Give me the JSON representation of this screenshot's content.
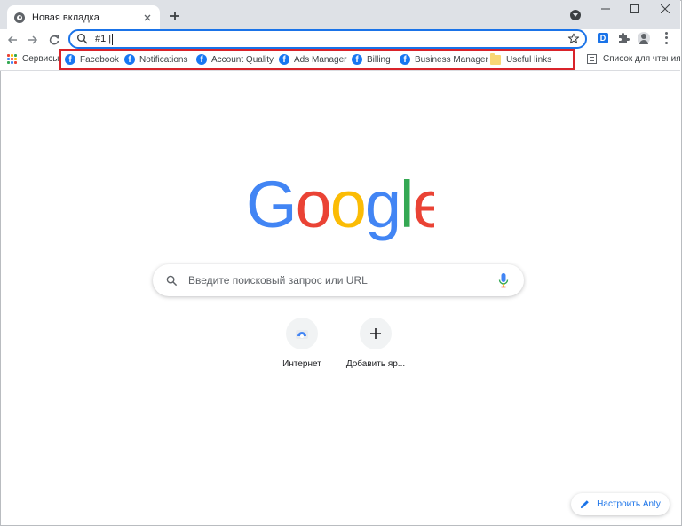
{
  "tab": {
    "title": "Новая вкладка",
    "close_icon": "close-icon",
    "new_tab_icon": "plus-icon"
  },
  "omnibox": {
    "value": "#1 |",
    "search_icon": "search-icon",
    "star_icon": "star-icon"
  },
  "toolbar": {
    "back_icon": "arrow-left-icon",
    "forward_icon": "arrow-right-icon",
    "reload_icon": "reload-icon",
    "extension_label": "D"
  },
  "bookmarks": {
    "apps_label": "Сервисы",
    "items": [
      {
        "label": "Facebook",
        "icon": "facebook-icon"
      },
      {
        "label": "Notifications",
        "icon": "facebook-icon"
      },
      {
        "label": "Account Quality",
        "icon": "facebook-icon"
      },
      {
        "label": "Ads Manager",
        "icon": "facebook-icon"
      },
      {
        "label": "Billing",
        "icon": "facebook-icon"
      },
      {
        "label": "Business Manager",
        "icon": "facebook-icon"
      },
      {
        "label": "Useful links",
        "icon": "folder-icon"
      }
    ],
    "reading_list_label": "Список для чтения",
    "highlight_color": "#d9232a"
  },
  "main": {
    "logo_text": "Google",
    "search_placeholder": "Введите поисковый запрос или URL",
    "shortcuts": [
      {
        "label": "Интернет",
        "icon": "web-store-icon"
      },
      {
        "label": "Добавить яр...",
        "icon": "plus-icon"
      }
    ],
    "customize_label": "Настроить Anty"
  },
  "colors": {
    "accent": "#1a73e8",
    "tab_strip": "#dee1e6",
    "facebook": "#1877f2"
  }
}
